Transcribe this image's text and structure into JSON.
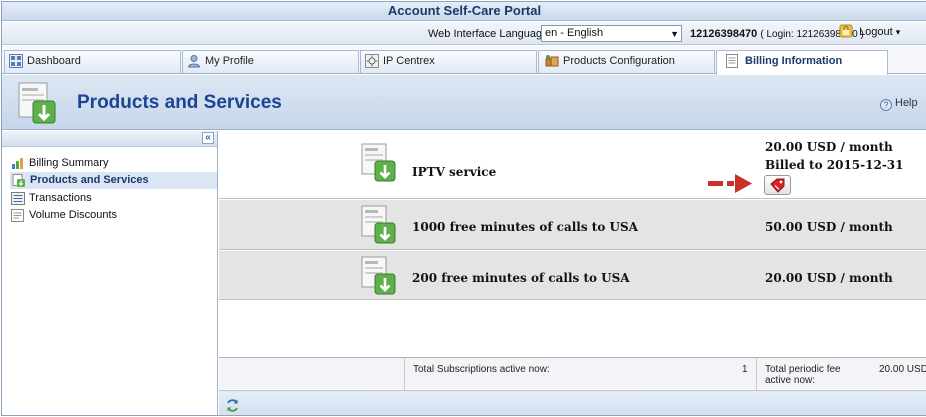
{
  "app": {
    "title": "Account Self-Care Portal"
  },
  "userbar": {
    "language_label": "Web Interface Language:",
    "language_value": "en - English",
    "account_id": "12126398470",
    "login_text": "( Login: 12126398470 )",
    "logout_label": "Logout"
  },
  "tabs": [
    {
      "label": "Dashboard",
      "icon": "dashboard-icon"
    },
    {
      "label": "My Profile",
      "icon": "user-icon"
    },
    {
      "label": "IP Centrex",
      "icon": "network-icon"
    },
    {
      "label": "Products Configuration",
      "icon": "products-icon"
    },
    {
      "label": "Billing Information",
      "icon": "document-icon",
      "active": true
    }
  ],
  "page": {
    "title": "Products and Services",
    "help_label": "Help"
  },
  "sidebar": {
    "collapse_label": "«",
    "items": [
      {
        "label": "Billing Summary",
        "icon": "chart-icon"
      },
      {
        "label": "Products and Services",
        "icon": "product-icon",
        "active": true
      },
      {
        "label": "Transactions",
        "icon": "list-icon"
      },
      {
        "label": "Volume Discounts",
        "icon": "discount-icon"
      }
    ]
  },
  "products": [
    {
      "name": "IPTV service",
      "price": "20.00 USD / month",
      "billed": "Billed to 2015-12-31"
    },
    {
      "name": "1000 free minutes of calls to USA",
      "price": "50.00 USD / month"
    },
    {
      "name": "200 free minutes of calls to USA",
      "price": "20.00 USD / month"
    }
  ],
  "totals": {
    "subscriptions_label": "Total Subscriptions active now:",
    "subscriptions_count": "1",
    "fee_label_line1": "Total periodic fee",
    "fee_label_line2": "active now:",
    "fee_value": "20.00 USD"
  },
  "colors": {
    "header_blue": "#1d4394",
    "annotation_red": "#c8322b",
    "tag_red": "#d8232a"
  }
}
